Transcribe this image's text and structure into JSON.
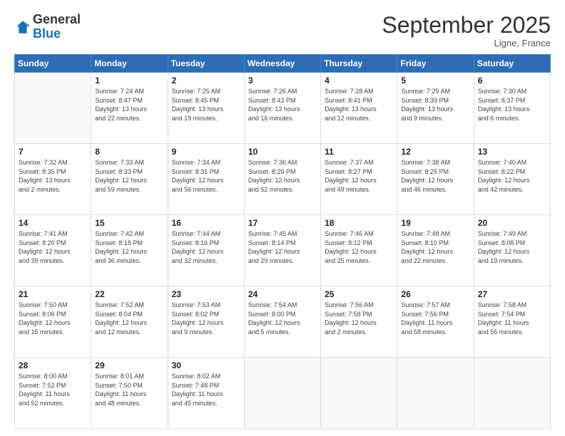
{
  "logo": {
    "general": "General",
    "blue": "Blue"
  },
  "title": "September 2025",
  "subtitle": "Ligne, France",
  "days_header": [
    "Sunday",
    "Monday",
    "Tuesday",
    "Wednesday",
    "Thursday",
    "Friday",
    "Saturday"
  ],
  "weeks": [
    [
      {
        "day": "",
        "info": ""
      },
      {
        "day": "1",
        "info": "Sunrise: 7:24 AM\nSunset: 8:47 PM\nDaylight: 13 hours\nand 22 minutes."
      },
      {
        "day": "2",
        "info": "Sunrise: 7:25 AM\nSunset: 8:45 PM\nDaylight: 13 hours\nand 19 minutes."
      },
      {
        "day": "3",
        "info": "Sunrise: 7:26 AM\nSunset: 8:43 PM\nDaylight: 13 hours\nand 16 minutes."
      },
      {
        "day": "4",
        "info": "Sunrise: 7:28 AM\nSunset: 8:41 PM\nDaylight: 13 hours\nand 12 minutes."
      },
      {
        "day": "5",
        "info": "Sunrise: 7:29 AM\nSunset: 8:39 PM\nDaylight: 13 hours\nand 9 minutes."
      },
      {
        "day": "6",
        "info": "Sunrise: 7:30 AM\nSunset: 8:37 PM\nDaylight: 13 hours\nand 6 minutes."
      }
    ],
    [
      {
        "day": "7",
        "info": "Sunrise: 7:32 AM\nSunset: 8:35 PM\nDaylight: 13 hours\nand 2 minutes."
      },
      {
        "day": "8",
        "info": "Sunrise: 7:33 AM\nSunset: 8:33 PM\nDaylight: 12 hours\nand 59 minutes."
      },
      {
        "day": "9",
        "info": "Sunrise: 7:34 AM\nSunset: 8:31 PM\nDaylight: 12 hours\nand 56 minutes."
      },
      {
        "day": "10",
        "info": "Sunrise: 7:36 AM\nSunset: 8:29 PM\nDaylight: 12 hours\nand 52 minutes."
      },
      {
        "day": "11",
        "info": "Sunrise: 7:37 AM\nSunset: 8:27 PM\nDaylight: 12 hours\nand 49 minutes."
      },
      {
        "day": "12",
        "info": "Sunrise: 7:38 AM\nSunset: 8:25 PM\nDaylight: 12 hours\nand 46 minutes."
      },
      {
        "day": "13",
        "info": "Sunrise: 7:40 AM\nSunset: 8:22 PM\nDaylight: 12 hours\nand 42 minutes."
      }
    ],
    [
      {
        "day": "14",
        "info": "Sunrise: 7:41 AM\nSunset: 8:20 PM\nDaylight: 12 hours\nand 39 minutes."
      },
      {
        "day": "15",
        "info": "Sunrise: 7:42 AM\nSunset: 8:18 PM\nDaylight: 12 hours\nand 36 minutes."
      },
      {
        "day": "16",
        "info": "Sunrise: 7:44 AM\nSunset: 8:16 PM\nDaylight: 12 hours\nand 32 minutes."
      },
      {
        "day": "17",
        "info": "Sunrise: 7:45 AM\nSunset: 8:14 PM\nDaylight: 12 hours\nand 29 minutes."
      },
      {
        "day": "18",
        "info": "Sunrise: 7:46 AM\nSunset: 8:12 PM\nDaylight: 12 hours\nand 25 minutes."
      },
      {
        "day": "19",
        "info": "Sunrise: 7:48 AM\nSunset: 8:10 PM\nDaylight: 12 hours\nand 22 minutes."
      },
      {
        "day": "20",
        "info": "Sunrise: 7:49 AM\nSunset: 8:08 PM\nDaylight: 12 hours\nand 19 minutes."
      }
    ],
    [
      {
        "day": "21",
        "info": "Sunrise: 7:50 AM\nSunset: 8:06 PM\nDaylight: 12 hours\nand 15 minutes."
      },
      {
        "day": "22",
        "info": "Sunrise: 7:52 AM\nSunset: 8:04 PM\nDaylight: 12 hours\nand 12 minutes."
      },
      {
        "day": "23",
        "info": "Sunrise: 7:53 AM\nSunset: 8:02 PM\nDaylight: 12 hours\nand 9 minutes."
      },
      {
        "day": "24",
        "info": "Sunrise: 7:54 AM\nSunset: 8:00 PM\nDaylight: 12 hours\nand 5 minutes."
      },
      {
        "day": "25",
        "info": "Sunrise: 7:56 AM\nSunset: 7:58 PM\nDaylight: 12 hours\nand 2 minutes."
      },
      {
        "day": "26",
        "info": "Sunrise: 7:57 AM\nSunset: 7:56 PM\nDaylight: 11 hours\nand 58 minutes."
      },
      {
        "day": "27",
        "info": "Sunrise: 7:58 AM\nSunset: 7:54 PM\nDaylight: 11 hours\nand 55 minutes."
      }
    ],
    [
      {
        "day": "28",
        "info": "Sunrise: 8:00 AM\nSunset: 7:52 PM\nDaylight: 11 hours\nand 52 minutes."
      },
      {
        "day": "29",
        "info": "Sunrise: 8:01 AM\nSunset: 7:50 PM\nDaylight: 11 hours\nand 48 minutes."
      },
      {
        "day": "30",
        "info": "Sunrise: 8:02 AM\nSunset: 7:48 PM\nDaylight: 11 hours\nand 45 minutes."
      },
      {
        "day": "",
        "info": ""
      },
      {
        "day": "",
        "info": ""
      },
      {
        "day": "",
        "info": ""
      },
      {
        "day": "",
        "info": ""
      }
    ]
  ]
}
